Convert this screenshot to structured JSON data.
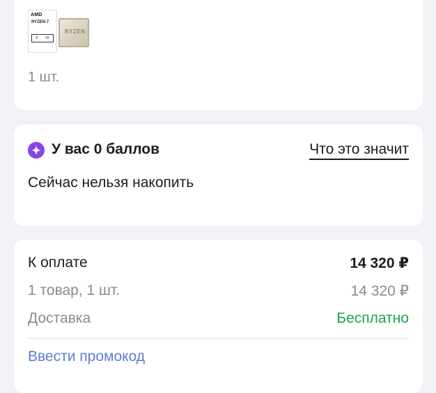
{
  "product": {
    "box_brand": "AMD",
    "box_model": "RYZEN 7",
    "box_cores": "8",
    "box_threads": "16",
    "chip_label": "RYZEN",
    "quantity": "1 шт."
  },
  "points": {
    "title": "У вас 0 баллов",
    "link": "Что это значит",
    "subtitle": "Сейчас нельзя накопить",
    "icon": "sparkle-icon",
    "icon_color": "#8b45e6"
  },
  "summary": {
    "pay_label": "К оплате",
    "pay_amount": "14 320 ₽",
    "items_label": "1 товар, 1 шт.",
    "items_amount": "14 320 ₽",
    "delivery_label": "Доставка",
    "delivery_value": "Бесплатно",
    "promo_link": "Ввести промокод",
    "free_color": "#1aa24a",
    "link_color": "#5b7fd6"
  }
}
